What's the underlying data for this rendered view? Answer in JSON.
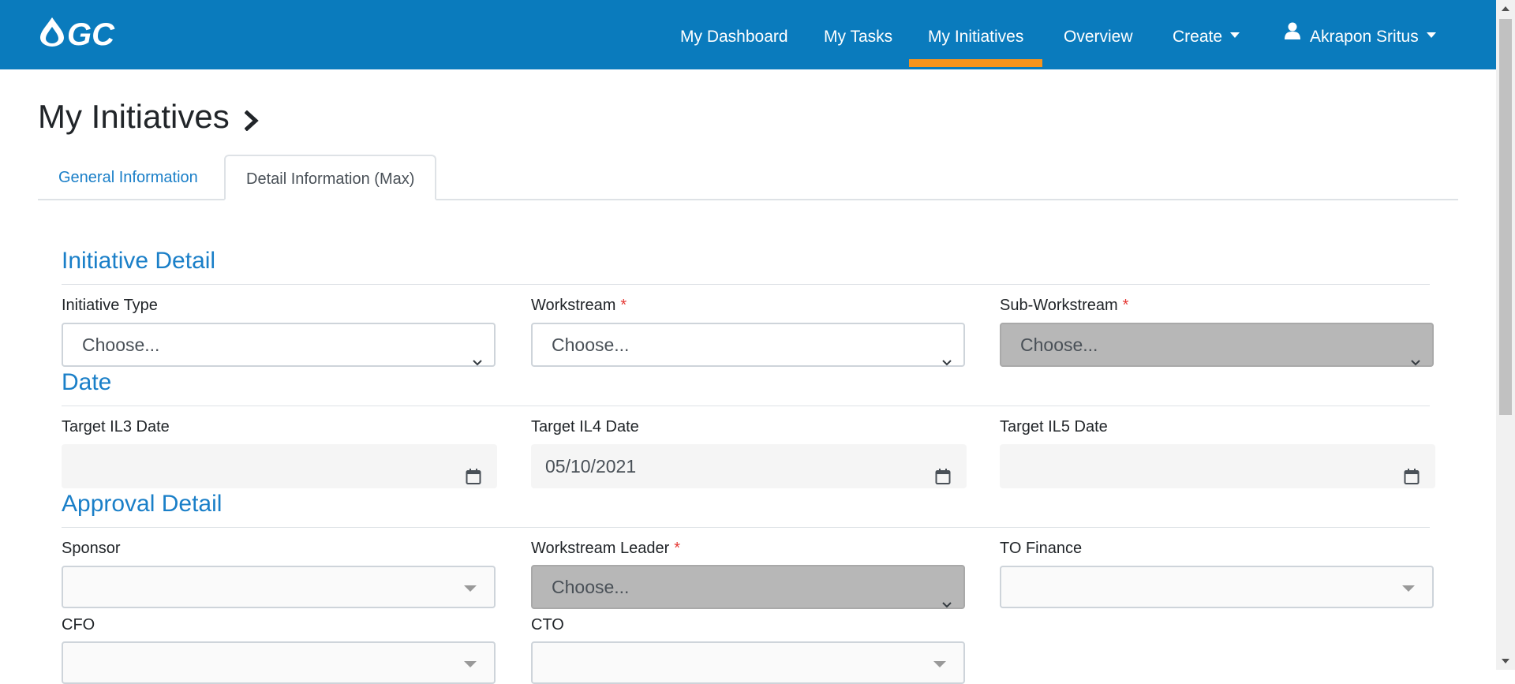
{
  "nav": {
    "items": [
      {
        "label": "My Dashboard"
      },
      {
        "label": "My Tasks"
      },
      {
        "label": "My Initiatives"
      },
      {
        "label": "Overview"
      },
      {
        "label": "Create"
      }
    ],
    "user": "Akrapon Sritus",
    "active_item": "My Initiatives"
  },
  "page": {
    "title": "My Initiatives",
    "tabs": [
      {
        "label": "General Information"
      },
      {
        "label": "Detail Information (Max)"
      }
    ]
  },
  "sections": {
    "initiative_detail": {
      "title": "Initiative Detail",
      "initiative_type": {
        "label": "Initiative Type",
        "value": "Choose..."
      },
      "workstream": {
        "label": "Workstream",
        "value": "Choose...",
        "required": "*"
      },
      "sub_workstream": {
        "label": "Sub-Workstream",
        "value": "Choose...",
        "required": "*"
      }
    },
    "date": {
      "title": "Date",
      "il3": {
        "label": "Target IL3 Date",
        "value": ""
      },
      "il4": {
        "label": "Target IL4 Date",
        "value": "05/10/2021"
      },
      "il5": {
        "label": "Target IL5 Date",
        "value": ""
      }
    },
    "approval_detail": {
      "title": "Approval Detail",
      "sponsor": {
        "label": "Sponsor"
      },
      "workstream_leader": {
        "label": "Workstream Leader",
        "value": "Choose...",
        "required": "*"
      },
      "to_finance": {
        "label": "TO Finance"
      },
      "cfo": {
        "label": "CFO"
      },
      "cto": {
        "label": "CTO"
      }
    }
  },
  "colors": {
    "navbar": "#0a7bbd",
    "active_underline": "#f7941d",
    "section_title": "#1a7fc8",
    "required": "#e53935"
  }
}
